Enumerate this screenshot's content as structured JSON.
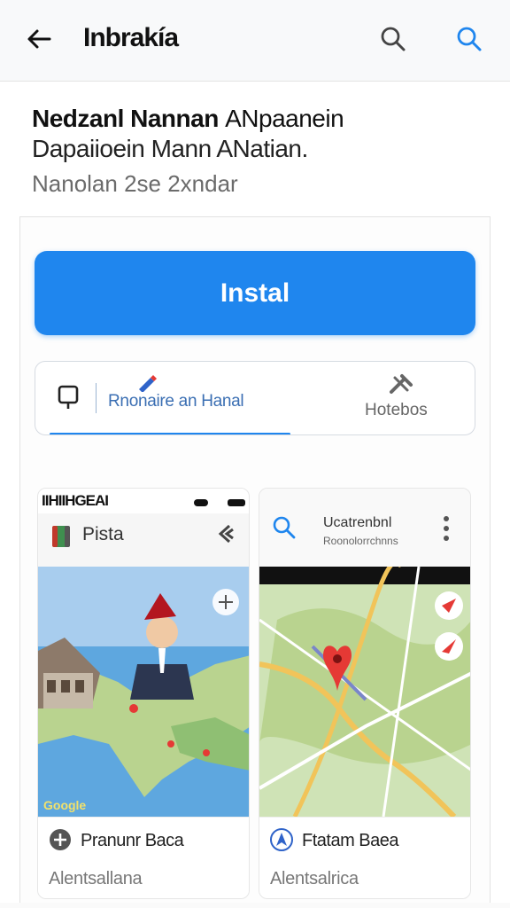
{
  "appbar": {
    "title": "Inbrakía",
    "back_icon": "arrow-left-icon",
    "search_icon": "search-icon"
  },
  "listing": {
    "title_bold": "Nedzanl Nannan",
    "title_rest": "ANpaanein",
    "subtitle": "Dapaiioein Mann ANatian.",
    "meta": "Nanolan 2se 2xndar"
  },
  "install": {
    "label": "Instal"
  },
  "tabs": [
    {
      "label": "Rnonaire an Hanal",
      "icon": "device-icon",
      "active": true
    },
    {
      "label": "Hotebos",
      "icon": "tools-icon",
      "active": false
    }
  ],
  "screenshots": [
    {
      "status_text": "IIHIIHGEAI",
      "header_name": "Pista",
      "map_brand": "Google",
      "footer_title": "Pranunr Baca",
      "footer_sub": "Alentsallana"
    },
    {
      "header_title": "Ucatrenbnl",
      "header_sub": "Roonolorrchnns",
      "footer_title": "Ftatam Baea",
      "footer_sub": "Alentsalrica"
    }
  ],
  "colors": {
    "accent": "#1f86ee",
    "map_water": "#5ea7df",
    "map_land": "#b9d38f",
    "road": "#f1c45a",
    "pin": "#e53935"
  }
}
